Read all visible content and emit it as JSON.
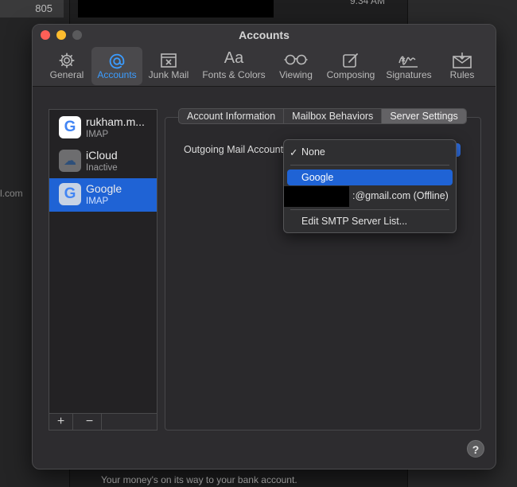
{
  "background": {
    "left_badge": "805",
    "left_snippet": "l.com",
    "time_snippet": "9:34 AM",
    "bottom_text": "Your money's on its way to your bank account."
  },
  "window": {
    "title": "Accounts"
  },
  "toolbar": {
    "items": [
      {
        "label": "General",
        "icon": "gear-icon"
      },
      {
        "label": "Accounts",
        "icon": "at-icon"
      },
      {
        "label": "Junk Mail",
        "icon": "junk-tray-icon"
      },
      {
        "label": "Fonts & Colors",
        "icon": "font-icon"
      },
      {
        "label": "Viewing",
        "icon": "glasses-icon"
      },
      {
        "label": "Composing",
        "icon": "compose-icon"
      },
      {
        "label": "Signatures",
        "icon": "signature-icon"
      },
      {
        "label": "Rules",
        "icon": "rules-envelope-icon"
      }
    ],
    "active": "Accounts"
  },
  "accounts": [
    {
      "name": "rukham.m...",
      "type": "IMAP",
      "logo": "G"
    },
    {
      "name": "iCloud",
      "type": "Inactive",
      "logo": "☁"
    },
    {
      "name": "Google",
      "type": "IMAP",
      "logo": "G"
    }
  ],
  "list_footer": {
    "add": "+",
    "remove": "−"
  },
  "tabs": [
    {
      "label": "Account Information"
    },
    {
      "label": "Mailbox Behaviors"
    },
    {
      "label": "Server Settings"
    }
  ],
  "outgoing": {
    "label": "Outgoing Mail Account"
  },
  "menu": {
    "check": "✓",
    "items": [
      {
        "label": "None"
      },
      {
        "label": "Google"
      },
      {
        "label": ":@gmail.com (Offline)"
      },
      {
        "label": "Edit SMTP Server List..."
      }
    ]
  },
  "help": "?",
  "colors": {
    "accent": "#1f63d5",
    "active_tab_text": "#3b9cff",
    "window_bg": "#2d2c2f"
  }
}
